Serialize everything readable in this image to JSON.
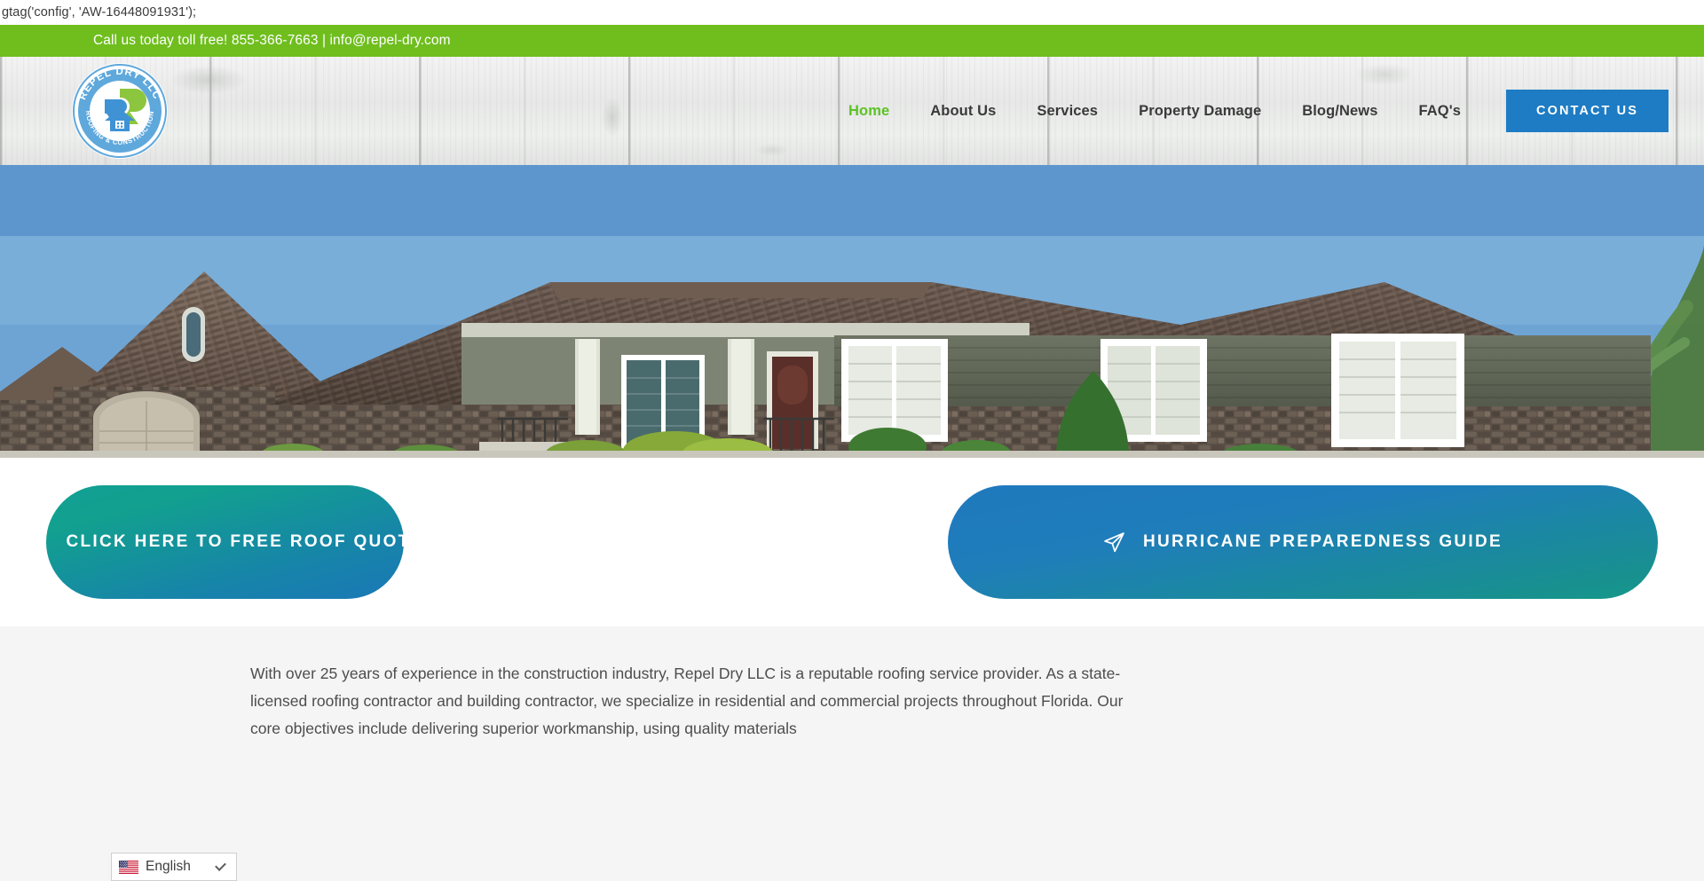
{
  "script_strip": {
    "text": "gtag('config', 'AW-16448091931');"
  },
  "topbar": {
    "text": "Call us today toll free! 855-366-7663 | info@repel-dry.com",
    "phone": "855-366-7663",
    "email": "info@repel-dry.com",
    "bg_color": "#6fbe1e"
  },
  "logo": {
    "name": "REPEL DRY LLC",
    "arc_top": "REPEL DRY LLC",
    "arc_bottom": "ROOFING & CONSTRUCTION",
    "monogram": "RD",
    "blue": "#5fa8dc",
    "green": "#8cc63f"
  },
  "nav": {
    "items": [
      {
        "label": "Home",
        "active": true
      },
      {
        "label": "About Us",
        "active": false
      },
      {
        "label": "Services",
        "active": false
      },
      {
        "label": "Property Damage",
        "active": false
      },
      {
        "label": "Blog/News",
        "active": false
      },
      {
        "label": "FAQ's",
        "active": false
      }
    ],
    "contact_label": "CONTACT US",
    "contact_color": "#1d7cc4",
    "active_color": "#5cc225"
  },
  "hero": {
    "alt": "Residential home with brown shingle roof, stone veneer facade and covered porch"
  },
  "cta": {
    "left": {
      "label": "CLICK HERE TO FREE ROOF QUOTE",
      "icon": "paper-plane-icon"
    },
    "right": {
      "label": "HURRICANE PREPAREDNESS GUIDE",
      "icon": "paper-plane-icon"
    }
  },
  "content": {
    "paragraph": "With over 25 years of experience in the construction industry, Repel Dry LLC is a reputable roofing service provider. As a state-licensed roofing contractor and building contractor, we specialize in residential and commercial projects throughout Florida. Our core objectives include delivering superior workmanship, using quality materials"
  },
  "language_picker": {
    "selected": "English",
    "flag": "us-flag-icon",
    "chevron": "chevron-down-icon"
  }
}
